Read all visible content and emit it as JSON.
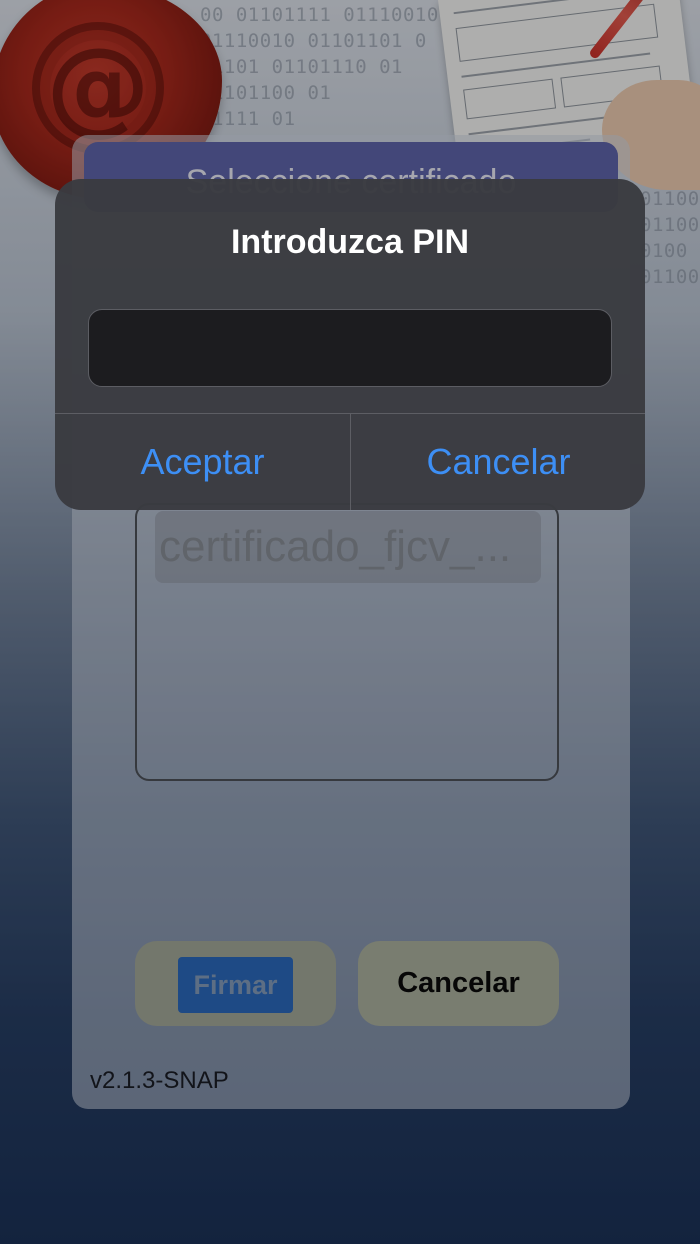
{
  "header": {
    "binary_rows": [
      "00 01101111 01110010",
      "  01110010 01101101 0",
      "  01101 01101110 01",
      "      01101100 01",
      "        01111 01"
    ],
    "binary_right": [
      "01100",
      "01100",
      "0100",
      "01100"
    ],
    "seal_glyph": "@"
  },
  "card": {
    "title": "Seleccione certificado",
    "certificates": [
      "certificado_fjcv_..."
    ],
    "sign_button": "Firmar",
    "cancel_button": "Cancelar",
    "version": "v2.1.3-SNAP"
  },
  "alert": {
    "title": "Introduzca PIN",
    "pin_value": "",
    "accept_label": "Aceptar",
    "cancel_label": "Cancelar"
  },
  "colors": {
    "alert_bg": "#3a3b40",
    "alert_button": "#3d8ff5",
    "title_bar": "#5d63a8",
    "sign_button": "#2a67b9"
  }
}
